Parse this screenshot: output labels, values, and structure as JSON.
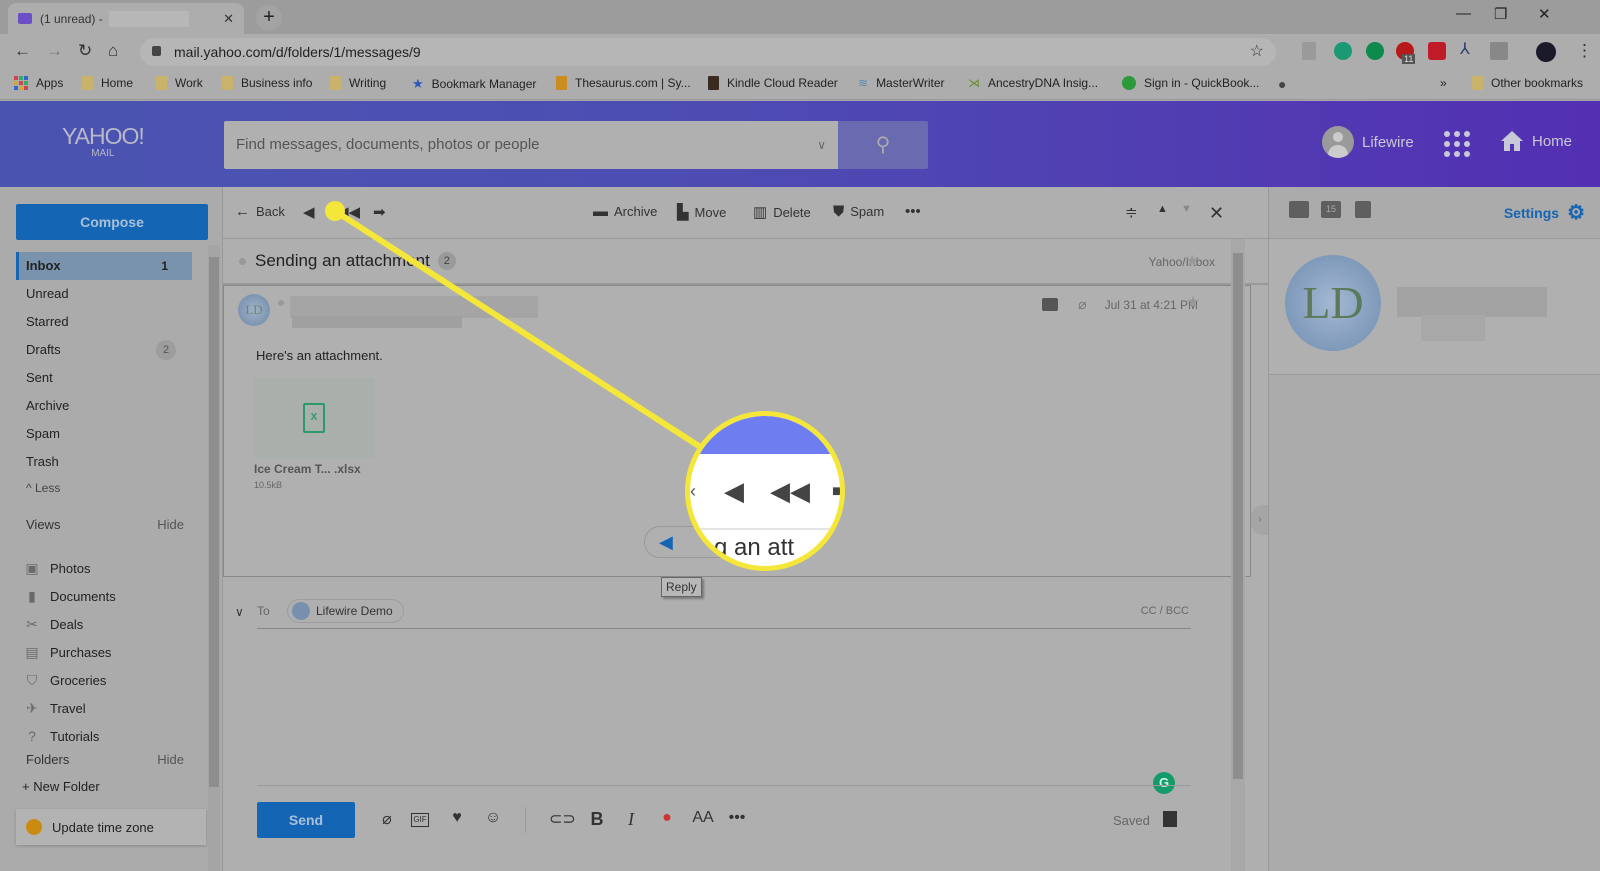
{
  "browser": {
    "tab_title": "(1 unread) -",
    "url": "mail.yahoo.com/d/folders/1/messages/9",
    "extension_badge": "11",
    "bookmarks": [
      {
        "label": "Apps",
        "icon": "apps-grid-icon"
      },
      {
        "label": "Home",
        "icon": "folder-icon"
      },
      {
        "label": "Work",
        "icon": "folder-icon"
      },
      {
        "label": "Business info",
        "icon": "folder-icon"
      },
      {
        "label": "Writing",
        "icon": "folder-icon"
      },
      {
        "label": "Bookmark Manager",
        "icon": "star-icon"
      },
      {
        "label": "Thesaurus.com | Sy...",
        "icon": "thesaurus-icon"
      },
      {
        "label": "Kindle Cloud Reader",
        "icon": "kindle-icon"
      },
      {
        "label": "MasterWriter",
        "icon": "masterwriter-icon"
      },
      {
        "label": "AncestryDNA Insig...",
        "icon": "ancestry-icon"
      },
      {
        "label": "Sign in - QuickBook...",
        "icon": "quickbooks-icon"
      }
    ],
    "other_bookmarks": "Other bookmarks",
    "overflow": "»"
  },
  "header": {
    "logo_main": "YAHOO!",
    "logo_sub": "MAIL",
    "search_placeholder": "Find messages, documents, photos or people",
    "user_name": "Lifewire",
    "home_label": "Home"
  },
  "sidebar": {
    "compose_label": "Compose",
    "folders": [
      {
        "label": "Inbox",
        "count": "1",
        "active": true
      },
      {
        "label": "Unread"
      },
      {
        "label": "Starred"
      },
      {
        "label": "Drafts",
        "pill": "2"
      },
      {
        "label": "Sent"
      },
      {
        "label": "Archive"
      },
      {
        "label": "Spam"
      },
      {
        "label": "Trash"
      }
    ],
    "less_label": "Less",
    "views_title": "Views",
    "views_hide": "Hide",
    "views": [
      {
        "label": "Photos",
        "icon": "photo-icon"
      },
      {
        "label": "Documents",
        "icon": "document-icon"
      },
      {
        "label": "Deals",
        "icon": "scissors-icon"
      },
      {
        "label": "Purchases",
        "icon": "receipt-icon"
      },
      {
        "label": "Groceries",
        "icon": "basket-icon"
      },
      {
        "label": "Travel",
        "icon": "plane-icon"
      },
      {
        "label": "Tutorials",
        "icon": "help-icon"
      }
    ],
    "folders_title": "Folders",
    "folders_hide": "Hide",
    "new_folder": "+ New Folder",
    "timezone_notice": "Update time zone"
  },
  "toolbar": {
    "back": "Back",
    "archive": "Archive",
    "move": "Move",
    "delete": "Delete",
    "spam": "Spam"
  },
  "message": {
    "subject": "Sending an attachment",
    "thread_count": "2",
    "folder_path": "Yahoo/Inbox",
    "sender_initials": "LD",
    "date": "Jul 31 at 4:21 PM",
    "body": "Here's an attachment.",
    "attachment": {
      "name": "Ice Cream T... .xlsx",
      "size": "10.5kB",
      "icon_text": "X"
    },
    "reply_tooltip": "Reply"
  },
  "compose": {
    "to_label": "To",
    "recipient": "Lifewire Demo",
    "cc_bcc": "CC / BCC",
    "send_label": "Send",
    "saved_status": "Saved",
    "gif_label": "GIF"
  },
  "right_pane": {
    "settings_label": "Settings",
    "calendar_day": "15",
    "contact_initials": "LD"
  },
  "callout": {
    "magnified_text": "g an att",
    "highlight_color": "#f5e63a"
  }
}
